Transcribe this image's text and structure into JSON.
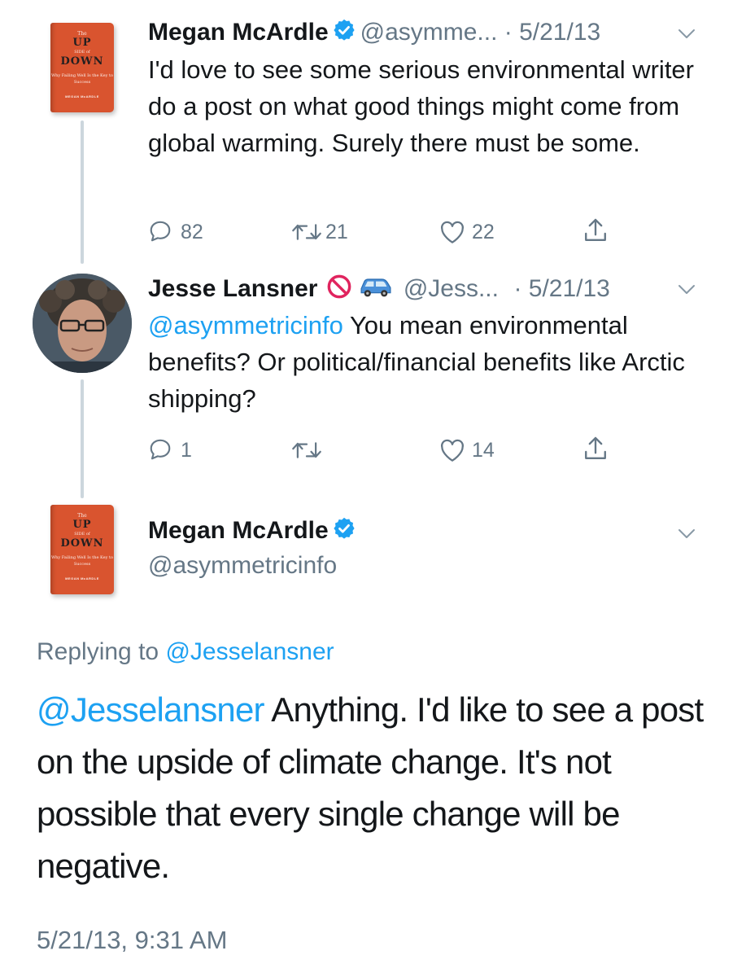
{
  "tweet1": {
    "name": "Megan McArdle",
    "handle_date": "@asymme... · 5/21/13",
    "text": "I'd love to see some serious environmental writer do a post on what good things might come from global warming. Surely there must be some.",
    "reply_count": "82",
    "retweet_count": "21",
    "like_count": "22"
  },
  "tweet2": {
    "name": "Jesse Lansner",
    "handle": "@Jess...",
    "date": "· 5/21/13",
    "mention": "@asymmetricinfo",
    "text": " You mean environmental benefits? Or political/financial benefits like Arctic shipping?",
    "reply_count": "1",
    "like_count": "14"
  },
  "book_cover": {
    "the": "The",
    "up": "UP",
    "side_of": "SIDE of",
    "down": "DOWN",
    "subtitle": "Why Failing Well Is the Key to Success",
    "author": "MEGAN McARDLE"
  },
  "tweet3": {
    "name": "Megan McArdle",
    "handle": "@asymmetricinfo",
    "replying_prefix": "Replying to ",
    "replying_to": "@Jesselansner",
    "mention": "@Jesselansner",
    "text": " Anything. I'd like to see a post on the upside of climate change. It's not possible that every single change will be negative.",
    "timestamp": "5/21/13, 9:31 AM"
  },
  "colors": {
    "link": "#1da1f2",
    "secondary": "#657786",
    "verified": "#1da1f2",
    "book": "#d9542f"
  }
}
